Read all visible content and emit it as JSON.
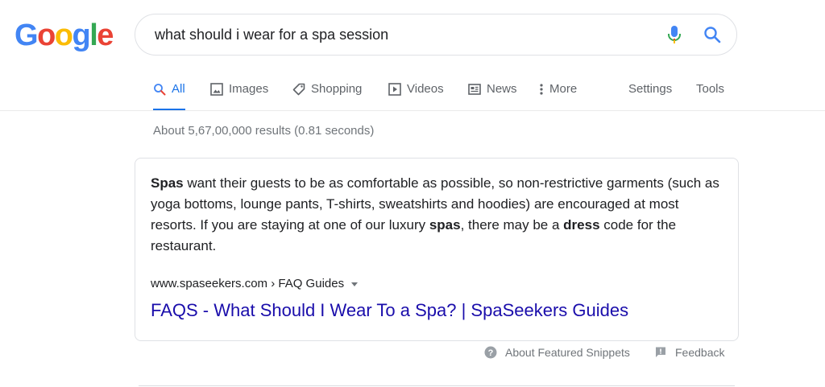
{
  "logo": {
    "letters": [
      "G",
      "o",
      "o",
      "g",
      "l",
      "e"
    ],
    "colors": [
      "#4285F4",
      "#EA4335",
      "#FBBC05",
      "#4285F4",
      "#34A853",
      "#EA4335"
    ]
  },
  "search": {
    "query": "what should i wear for a spa session"
  },
  "tabs": [
    {
      "label": "All",
      "icon": "search-icon"
    },
    {
      "label": "Images",
      "icon": "image-icon"
    },
    {
      "label": "Shopping",
      "icon": "tag-icon"
    },
    {
      "label": "Videos",
      "icon": "play-icon"
    },
    {
      "label": "News",
      "icon": "newspaper-icon"
    },
    {
      "label": "More",
      "icon": "more-vertical-icon"
    },
    {
      "label": "Settings"
    },
    {
      "label": "Tools"
    }
  ],
  "active_tab": "All",
  "result_stats": "About 5,67,00,000 results (0.81 seconds)",
  "snippet": {
    "segments": [
      {
        "text": "Spas",
        "bold": true
      },
      {
        "text": " want their guests to be as comfortable as possible, so non-restrictive garments (such as yoga bottoms, lounge pants, T-shirts, sweatshirts and hoodies) are encouraged at most resorts. If you are staying at one of our luxury ",
        "bold": false
      },
      {
        "text": "spas",
        "bold": true
      },
      {
        "text": ", there may be a ",
        "bold": false
      },
      {
        "text": "dress",
        "bold": true
      },
      {
        "text": " code for the restaurant.",
        "bold": false
      }
    ],
    "cite": "www.spaseekers.com › FAQ Guides",
    "link_title": "FAQS - What Should I Wear To a Spa? | SpaSeekers Guides"
  },
  "footer": {
    "about_snippets": "About Featured Snippets",
    "feedback": "Feedback"
  },
  "colors": {
    "link": "#1a0dab",
    "accent": "#1a73e8",
    "muted": "#70757a"
  }
}
